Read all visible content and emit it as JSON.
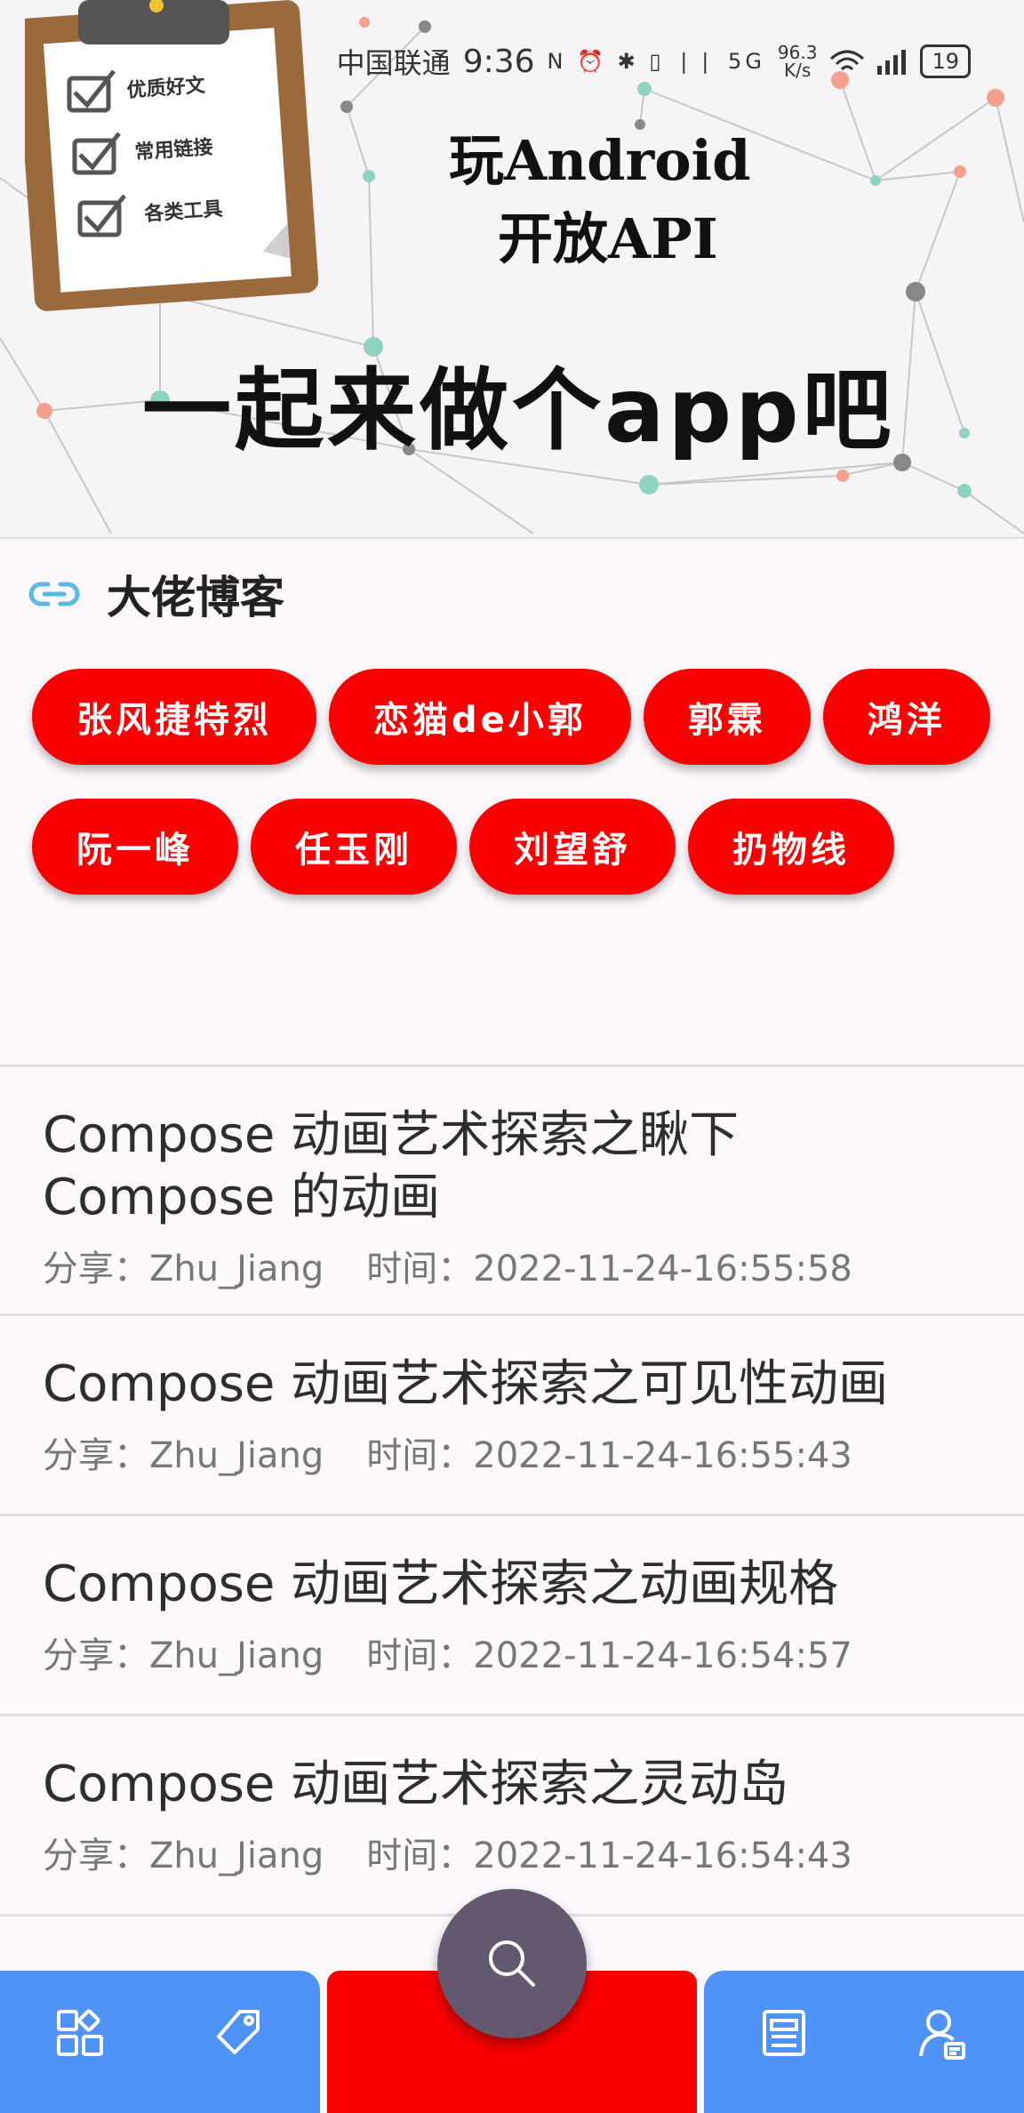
{
  "status_bar": {
    "carrier": "中国联通",
    "time": "9:36",
    "speed_value": "96.3",
    "speed_unit": "K/s",
    "battery": "19",
    "icons": "N ⏰ ✱ ▯ ❘❘ 5G"
  },
  "banner": {
    "clipboard_items": [
      "优质好文",
      "常用链接",
      "各类工具"
    ],
    "title_line1": "玩Android",
    "title_line2": "开放API",
    "slogan": "一起来做个app吧"
  },
  "section": {
    "title": "大佬博客",
    "icon": "link-icon"
  },
  "tags": [
    {
      "label": "张风捷特烈"
    },
    {
      "label": "恋猫de小郭"
    },
    {
      "label": "郭霖"
    },
    {
      "label": "鸿洋"
    },
    {
      "label": "阮一峰"
    },
    {
      "label": "任玉刚"
    },
    {
      "label": "刘望舒"
    },
    {
      "label": "扔物线"
    }
  ],
  "articles": [
    {
      "title": "Compose 动画艺术探索之瞅下 Compose 的动画",
      "share_label": "分享：Zhu_Jiang",
      "time_label": "时间：2022-11-24-16:55:58"
    },
    {
      "title": "Compose 动画艺术探索之可见性动画",
      "share_label": "分享：Zhu_Jiang",
      "time_label": "时间：2022-11-24-16:55:43"
    },
    {
      "title": "Compose 动画艺术探索之动画规格",
      "share_label": "分享：Zhu_Jiang",
      "time_label": "时间：2022-11-24-16:54:57"
    },
    {
      "title": "Compose 动画艺术探索之灵动岛",
      "share_label": "分享：Zhu_Jiang",
      "time_label": "时间：2022-11-24-16:54:43"
    }
  ],
  "bottom_nav": {
    "items": [
      "grid-icon",
      "tag-icon",
      "search-icon",
      "article-icon",
      "profile-icon"
    ],
    "colors": {
      "side": "#4f93f7",
      "middle": "#fb0000",
      "fab": "#63586e",
      "tag": "#fb0000"
    }
  }
}
